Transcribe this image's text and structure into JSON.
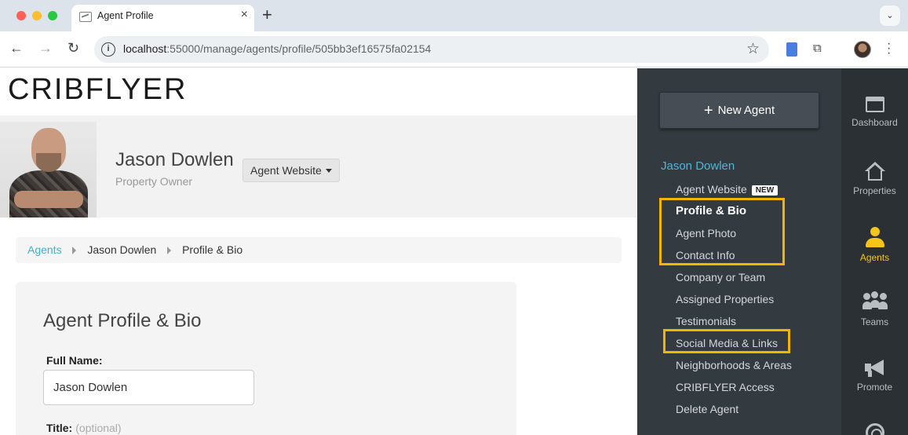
{
  "browser": {
    "tab_title": "Agent Profile",
    "url_host": "localhost",
    "url_rest": ":55000/manage/agents/profile/505bb3ef16575fa02154"
  },
  "logo": "CRIBFLYER",
  "agent": {
    "name": "Jason Dowlen",
    "role": "Property Owner",
    "website_button": "Agent Website"
  },
  "breadcrumb": {
    "root": "Agents",
    "agent": "Jason Dowlen",
    "current": "Profile & Bio"
  },
  "form": {
    "title": "Agent Profile & Bio",
    "full_name_label": "Full Name:",
    "full_name_value": "Jason Dowlen",
    "title_label": "Title:",
    "title_optional": "(optional)"
  },
  "sidebar": {
    "new_agent_label": "New Agent",
    "agent_name": "Jason Dowlen",
    "new_badge": "NEW",
    "items": [
      "Agent Website",
      "Profile & Bio",
      "Agent Photo",
      "Contact Info",
      "Company or Team",
      "Assigned Properties",
      "Testimonials",
      "Social Media & Links",
      "Neighborhoods & Areas",
      "CRIBFLYER Access",
      "Delete Agent"
    ],
    "highlight_color": "#f2b500",
    "link_color": "#4db8d8"
  },
  "iconnav": {
    "dashboard": "Dashboard",
    "properties": "Properties",
    "agents": "Agents",
    "teams": "Teams",
    "promote": "Promote",
    "active_color": "#f5c518"
  }
}
